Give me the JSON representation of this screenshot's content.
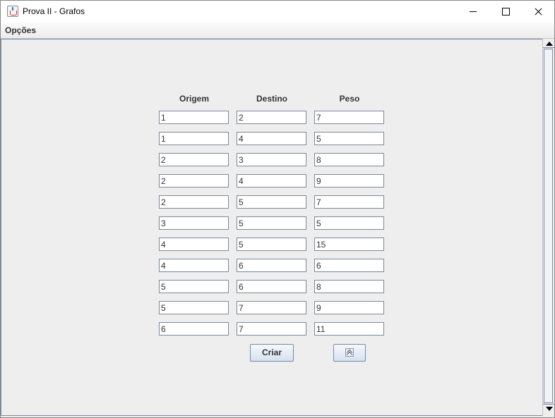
{
  "window": {
    "title": "Prova II - Grafos",
    "icon": "java-cup-icon"
  },
  "menubar": {
    "items": [
      "Opções"
    ]
  },
  "table": {
    "headers": [
      "Origem",
      "Destino",
      "Peso"
    ],
    "rows": [
      [
        "1",
        "2",
        "7"
      ],
      [
        "1",
        "4",
        "5"
      ],
      [
        "2",
        "3",
        "8"
      ],
      [
        "2",
        "4",
        "9"
      ],
      [
        "2",
        "5",
        "7"
      ],
      [
        "3",
        "5",
        "5"
      ],
      [
        "4",
        "5",
        "15"
      ],
      [
        "4",
        "6",
        "6"
      ],
      [
        "5",
        "6",
        "8"
      ],
      [
        "5",
        "7",
        "9"
      ],
      [
        "6",
        "7",
        "11"
      ]
    ]
  },
  "actions": {
    "create_label": "Criar",
    "icon_button": "chevrons-up-icon"
  }
}
